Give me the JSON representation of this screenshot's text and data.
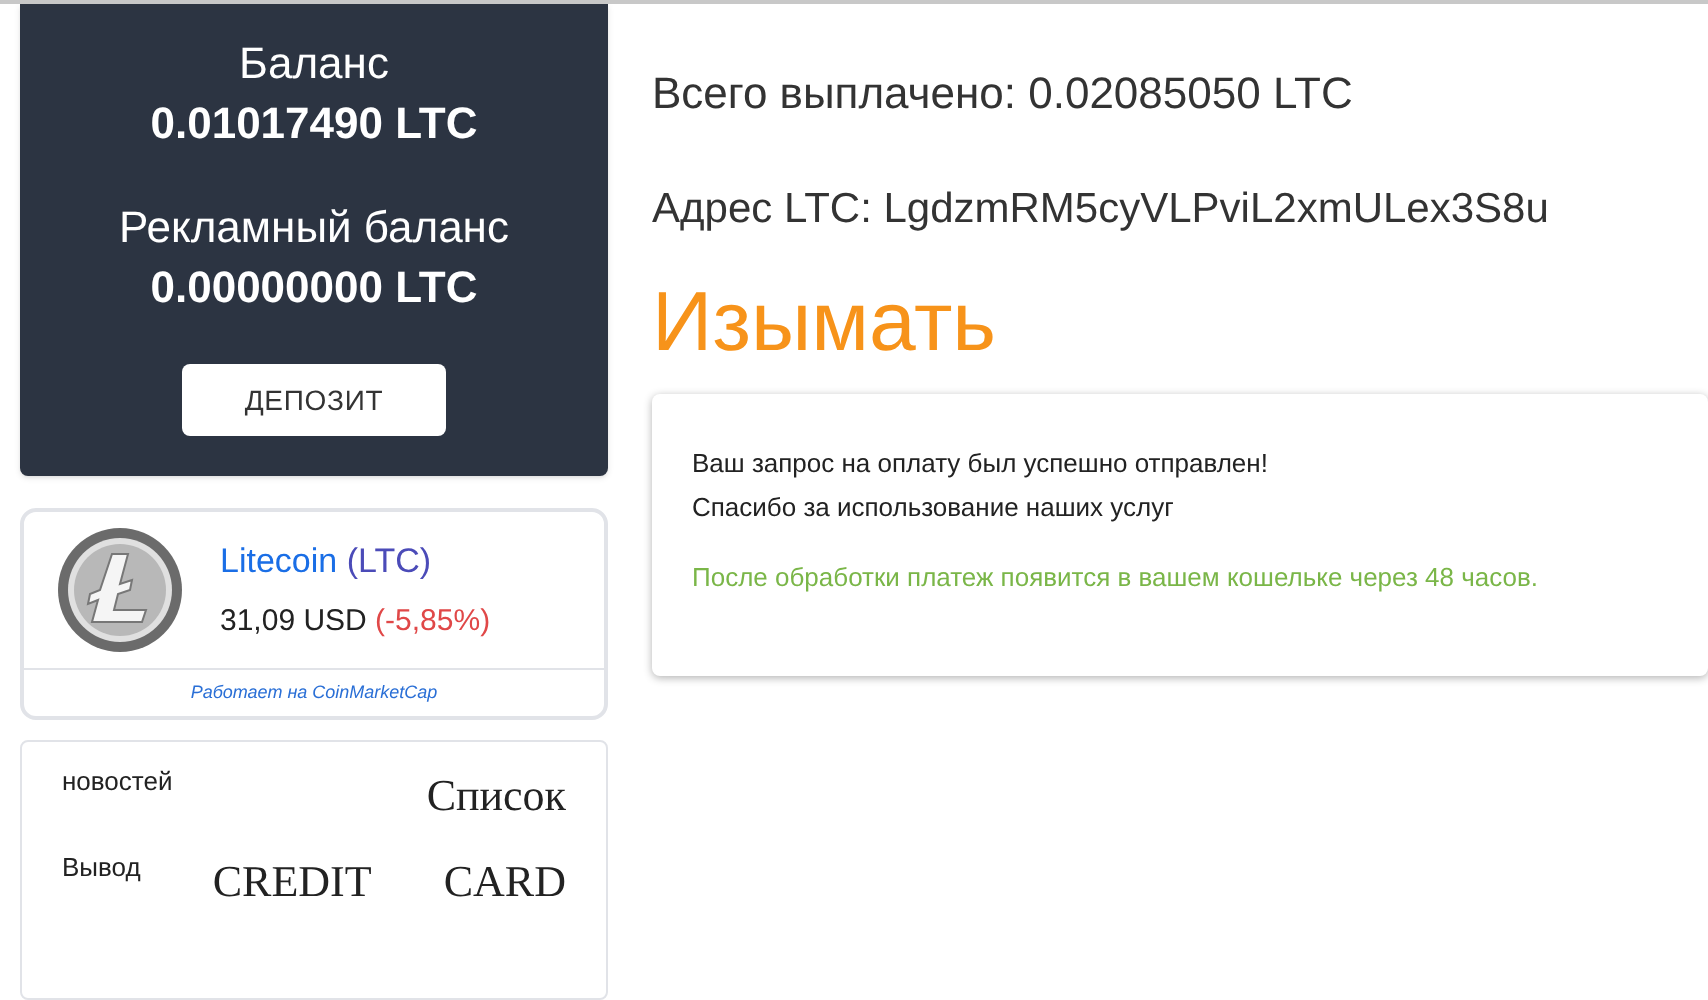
{
  "balance_card": {
    "balance_label": "Баланс",
    "balance_value": "0.01017490 LTC",
    "ad_balance_label": "Рекламный баланс",
    "ad_balance_value": "0.00000000 LTC",
    "deposit_button": "ДЕПОЗИТ"
  },
  "coin_widget": {
    "name": "Litecoin",
    "symbol": "(LTC)",
    "price": "31,09 USD",
    "change": "(-5,85%)",
    "footer": "Работает на CoinMarketCap"
  },
  "ad_box": {
    "lines": [
      [
        "новостей",
        "Список"
      ],
      [
        "Вывод",
        "CREDIT",
        "CARD"
      ]
    ]
  },
  "total_paid": "Всего выплачено: 0.02085050 LTC",
  "address": "Адрес LTC: LgdzmRM5cyVLPviL2xmULex3S8u",
  "heading": "Изымать",
  "message": {
    "lines": [
      "Ваш запрос на оплату был успешно отправлен!",
      "Спасибо за использование наших услуг"
    ],
    "note": "После обработки платеж появится в вашем кошельке через 48 часов."
  }
}
